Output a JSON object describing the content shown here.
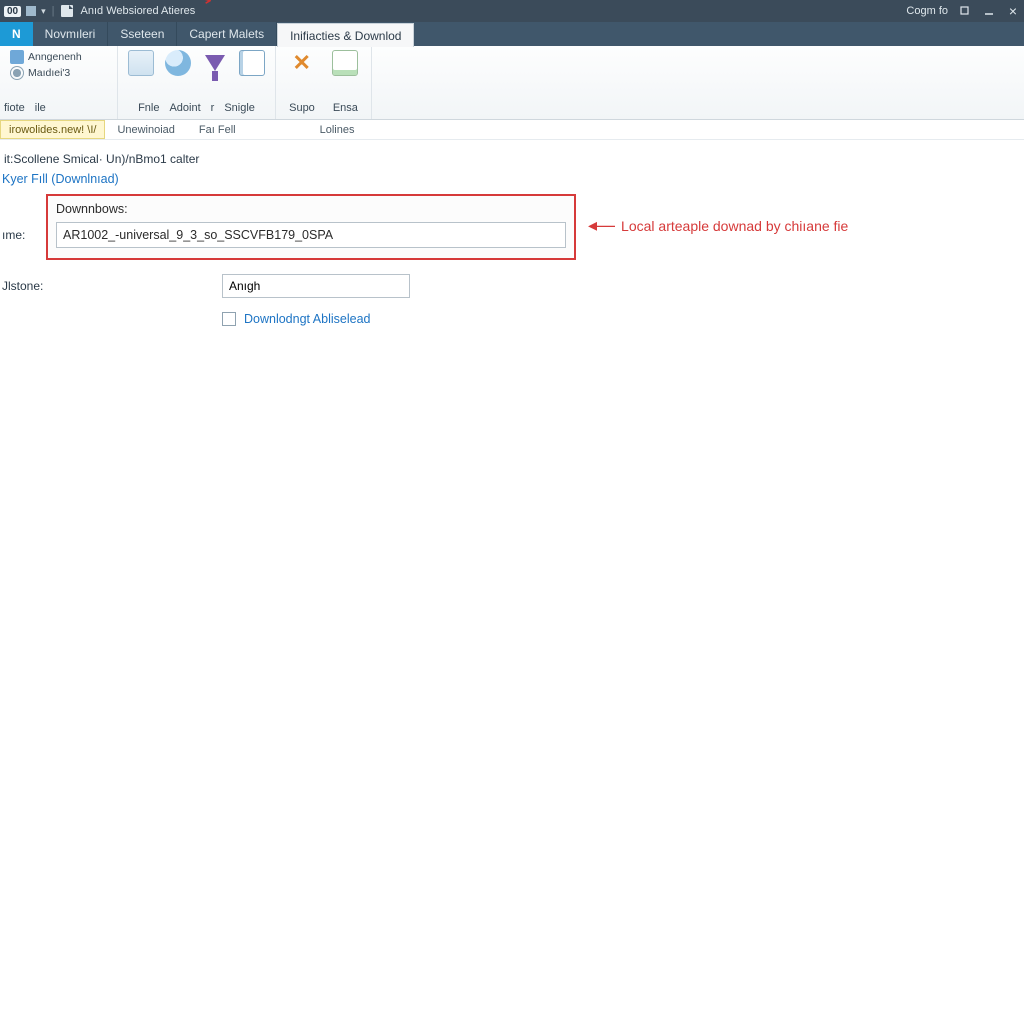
{
  "titlebar": {
    "badge": "00",
    "title": "Anıd Websiored Atieres",
    "signin": "Cogm fo"
  },
  "tabs": {
    "home": "N",
    "items": [
      "Novmıleri",
      "Sseteen",
      "Capert Malets"
    ],
    "active": "Inifiacties & Downlod"
  },
  "ribbon": {
    "group1": {
      "row1": "Anngenenh",
      "row2": "Maıdıei'3",
      "lbl1": "fiote",
      "lbl2": "ile"
    },
    "group2": {
      "file": "Fnle",
      "adoint": "Adoint",
      "mid": "r",
      "single": "Snigle"
    },
    "group3": {
      "supo": "Supo",
      "ensa": "Ensa"
    }
  },
  "pathbar": {
    "first": "irowolides.new! \\I/",
    "items": [
      "Unewinoiad",
      "Faı Fell",
      "Lolines"
    ]
  },
  "crumb": "it:Scollene Smical· Un)/nBmo1 calter",
  "linkline": "Kyer Fıll (Downlnıad)",
  "highlight": {
    "title": "Downnbows:",
    "value": "AR1002_-universal_9_3_so_SSCVFB179_0SPA"
  },
  "callout": "Local arteaple downad by chiıane fie",
  "form": {
    "name_lbl": "ıme:",
    "distone_lbl": "Jlstone:",
    "distone_val": "Anıgh",
    "checkbox": "Downlodngt Abliselead"
  }
}
